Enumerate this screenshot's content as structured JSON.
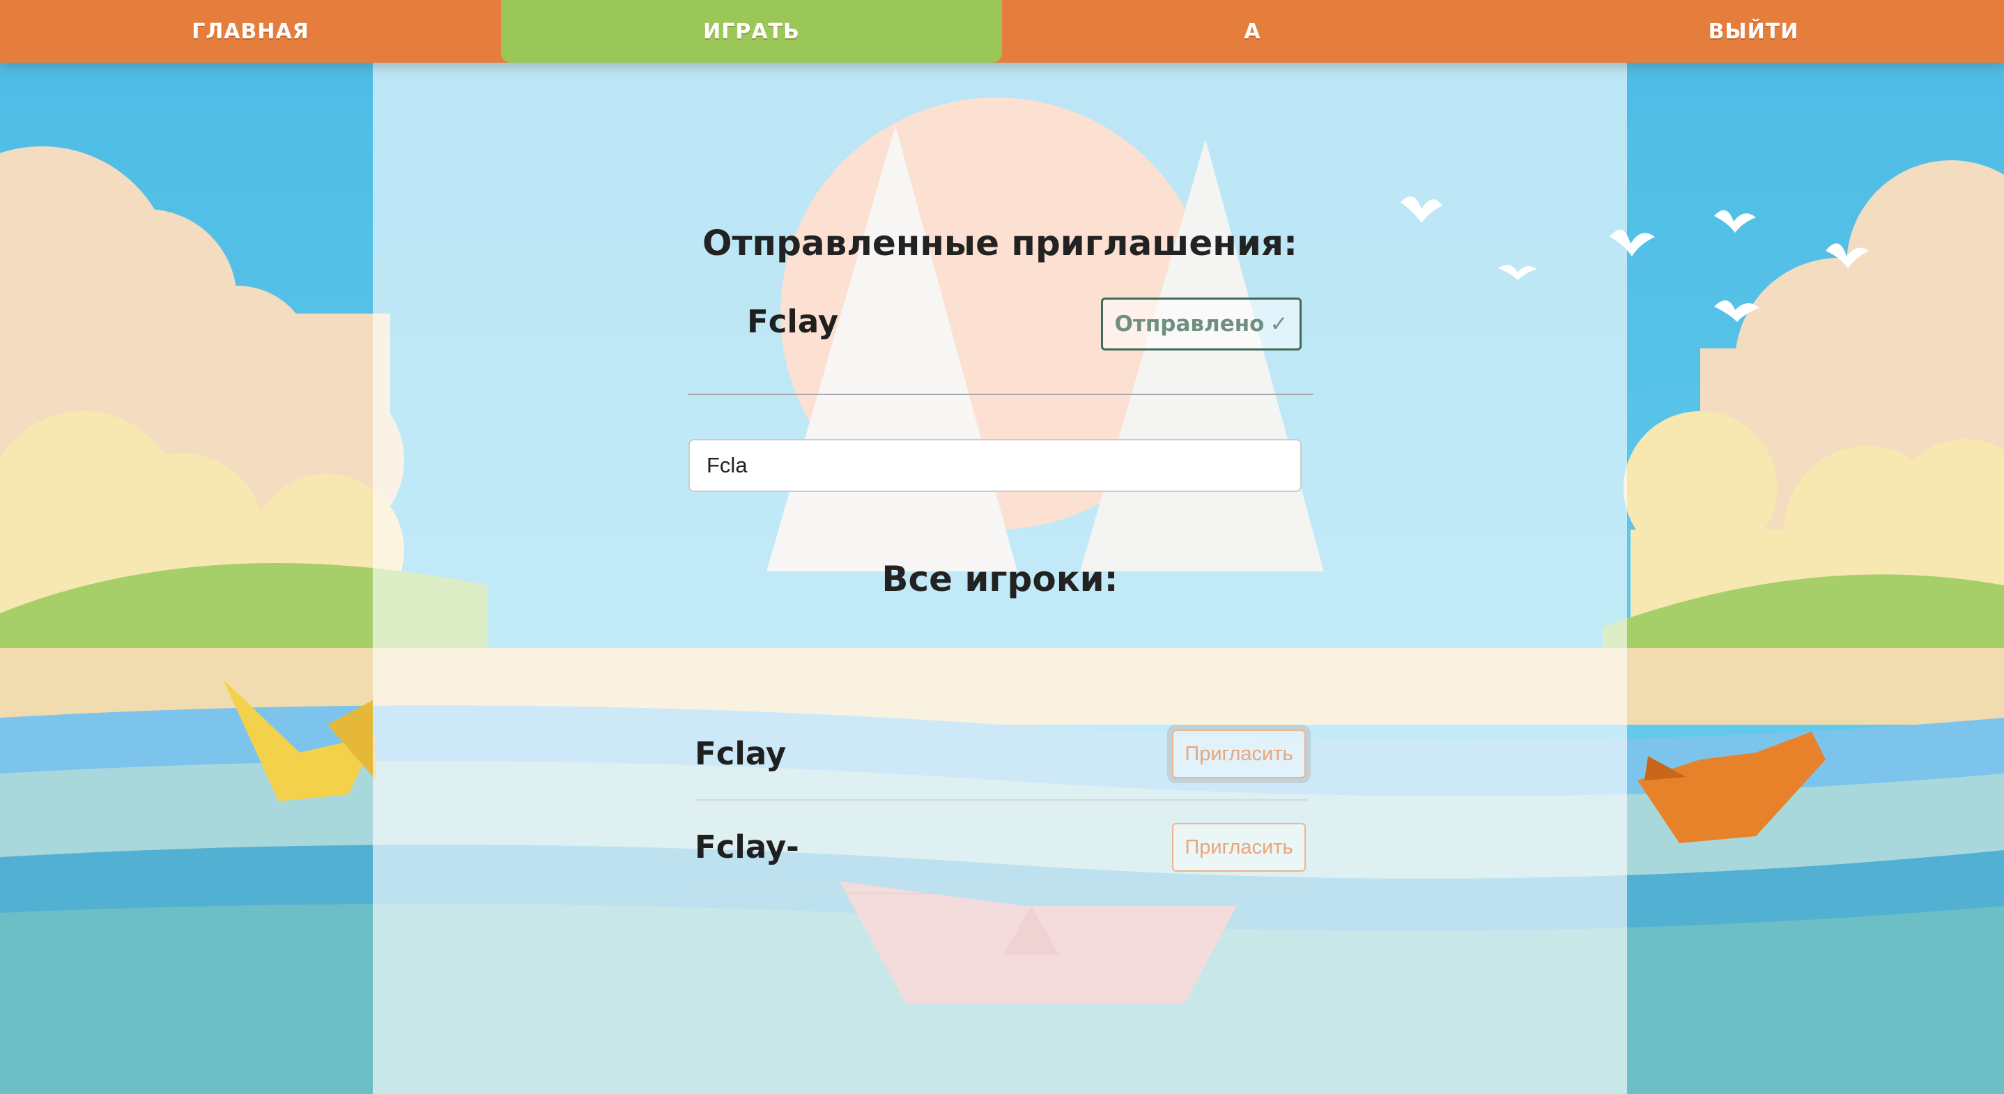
{
  "nav": {
    "items": [
      {
        "label": "ГЛАВНАЯ",
        "active": false
      },
      {
        "label": "ИГРАТЬ",
        "active": true
      },
      {
        "label": "А",
        "active": false
      },
      {
        "label": "ВЫЙТИ",
        "active": false
      }
    ]
  },
  "sent_invitations": {
    "title": "Отправленные приглашения:",
    "items": [
      {
        "name": "Fclay",
        "status_label": "Отправлено",
        "status_icon": "✓"
      }
    ]
  },
  "search": {
    "value": "Fcla"
  },
  "all_players": {
    "title": "Все игроки:",
    "items": [
      {
        "name": "Fclay",
        "button_label": "Пригласить"
      },
      {
        "name": "Fclay-",
        "button_label": "Пригласить"
      }
    ]
  },
  "colors": {
    "nav_bg": "#e57d3c",
    "nav_active": "#9ac757",
    "sent_border": "#3f6b58",
    "invite_border": "#f0b48a"
  }
}
